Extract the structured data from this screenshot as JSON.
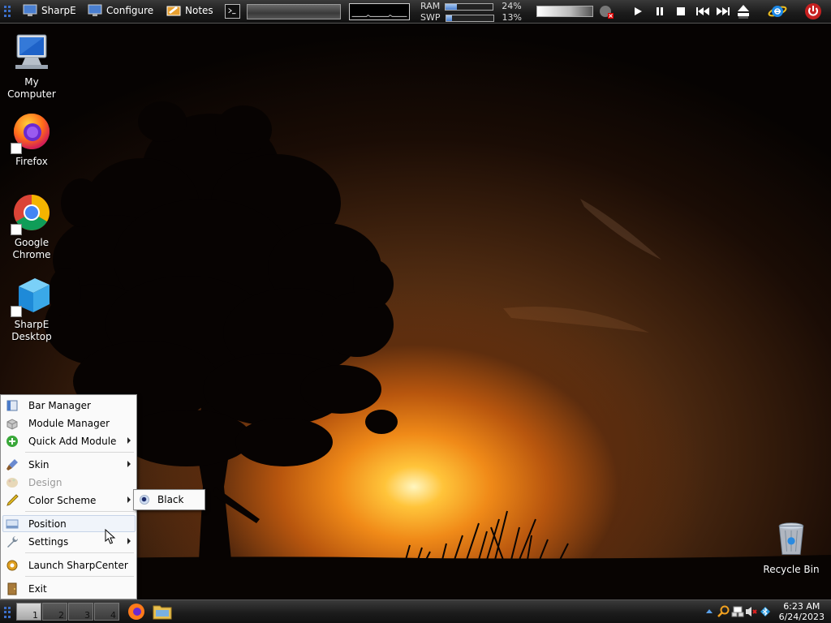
{
  "top_bar": {
    "app_button_label": "SharpE",
    "configure_label": "Configure",
    "notes_label": "Notes",
    "ram_label": "RAM",
    "ram_percent": "24%",
    "ram_value": 0.24,
    "swp_label": "SWP",
    "swp_percent": "13%",
    "swp_value": 0.13,
    "media_controls": [
      "play",
      "pause",
      "stop",
      "previous",
      "next"
    ],
    "icons": [
      "command-prompt-icon",
      "volume-muted-icon",
      "eject-icon",
      "internet-explorer-icon",
      "power-icon"
    ]
  },
  "desktop_icons": [
    {
      "label": "My Computer",
      "icon": "my-computer-icon"
    },
    {
      "label": "Firefox",
      "icon": "firefox-icon"
    },
    {
      "label": "Google Chrome",
      "icon": "chrome-icon"
    },
    {
      "label": "SharpE Desktop",
      "icon": "sharpe-desktop-icon"
    },
    {
      "label": "Recycle Bin",
      "icon": "recycle-bin-icon"
    }
  ],
  "menu": {
    "items": [
      {
        "label": "Bar Manager",
        "has_submenu": false,
        "enabled": true
      },
      {
        "label": "Module Manager",
        "has_submenu": false,
        "enabled": true
      },
      {
        "label": "Quick Add Module",
        "has_submenu": true,
        "enabled": true
      },
      {
        "label": "Skin",
        "has_submenu": true,
        "enabled": true
      },
      {
        "label": "Design",
        "has_submenu": false,
        "enabled": false
      },
      {
        "label": "Color Scheme",
        "has_submenu": true,
        "enabled": true
      },
      {
        "label": "Position",
        "has_submenu": false,
        "enabled": true,
        "highlighted": true
      },
      {
        "label": "Settings",
        "has_submenu": true,
        "enabled": true
      },
      {
        "label": "Launch SharpCenter",
        "has_submenu": false,
        "enabled": true
      },
      {
        "label": "Exit",
        "has_submenu": false,
        "enabled": true
      }
    ],
    "color_scheme_submenu": {
      "selected": "Black"
    }
  },
  "taskbar": {
    "virtual_desktops": [
      "1",
      "2",
      "3",
      "4"
    ],
    "active_desktop": "1",
    "tray_icons": [
      "up-arrow-icon",
      "search-icon",
      "network-icon",
      "volume-muted-icon",
      "bluetooth-icon"
    ],
    "clock_time": "6:23 AM",
    "clock_date": "6/24/2023"
  },
  "colors": {
    "bar_bg": "#1c1c1c",
    "accent_blue": "#3c6fc9",
    "sun_orange": "#f08a18",
    "menu_bg": "#fafafa"
  }
}
